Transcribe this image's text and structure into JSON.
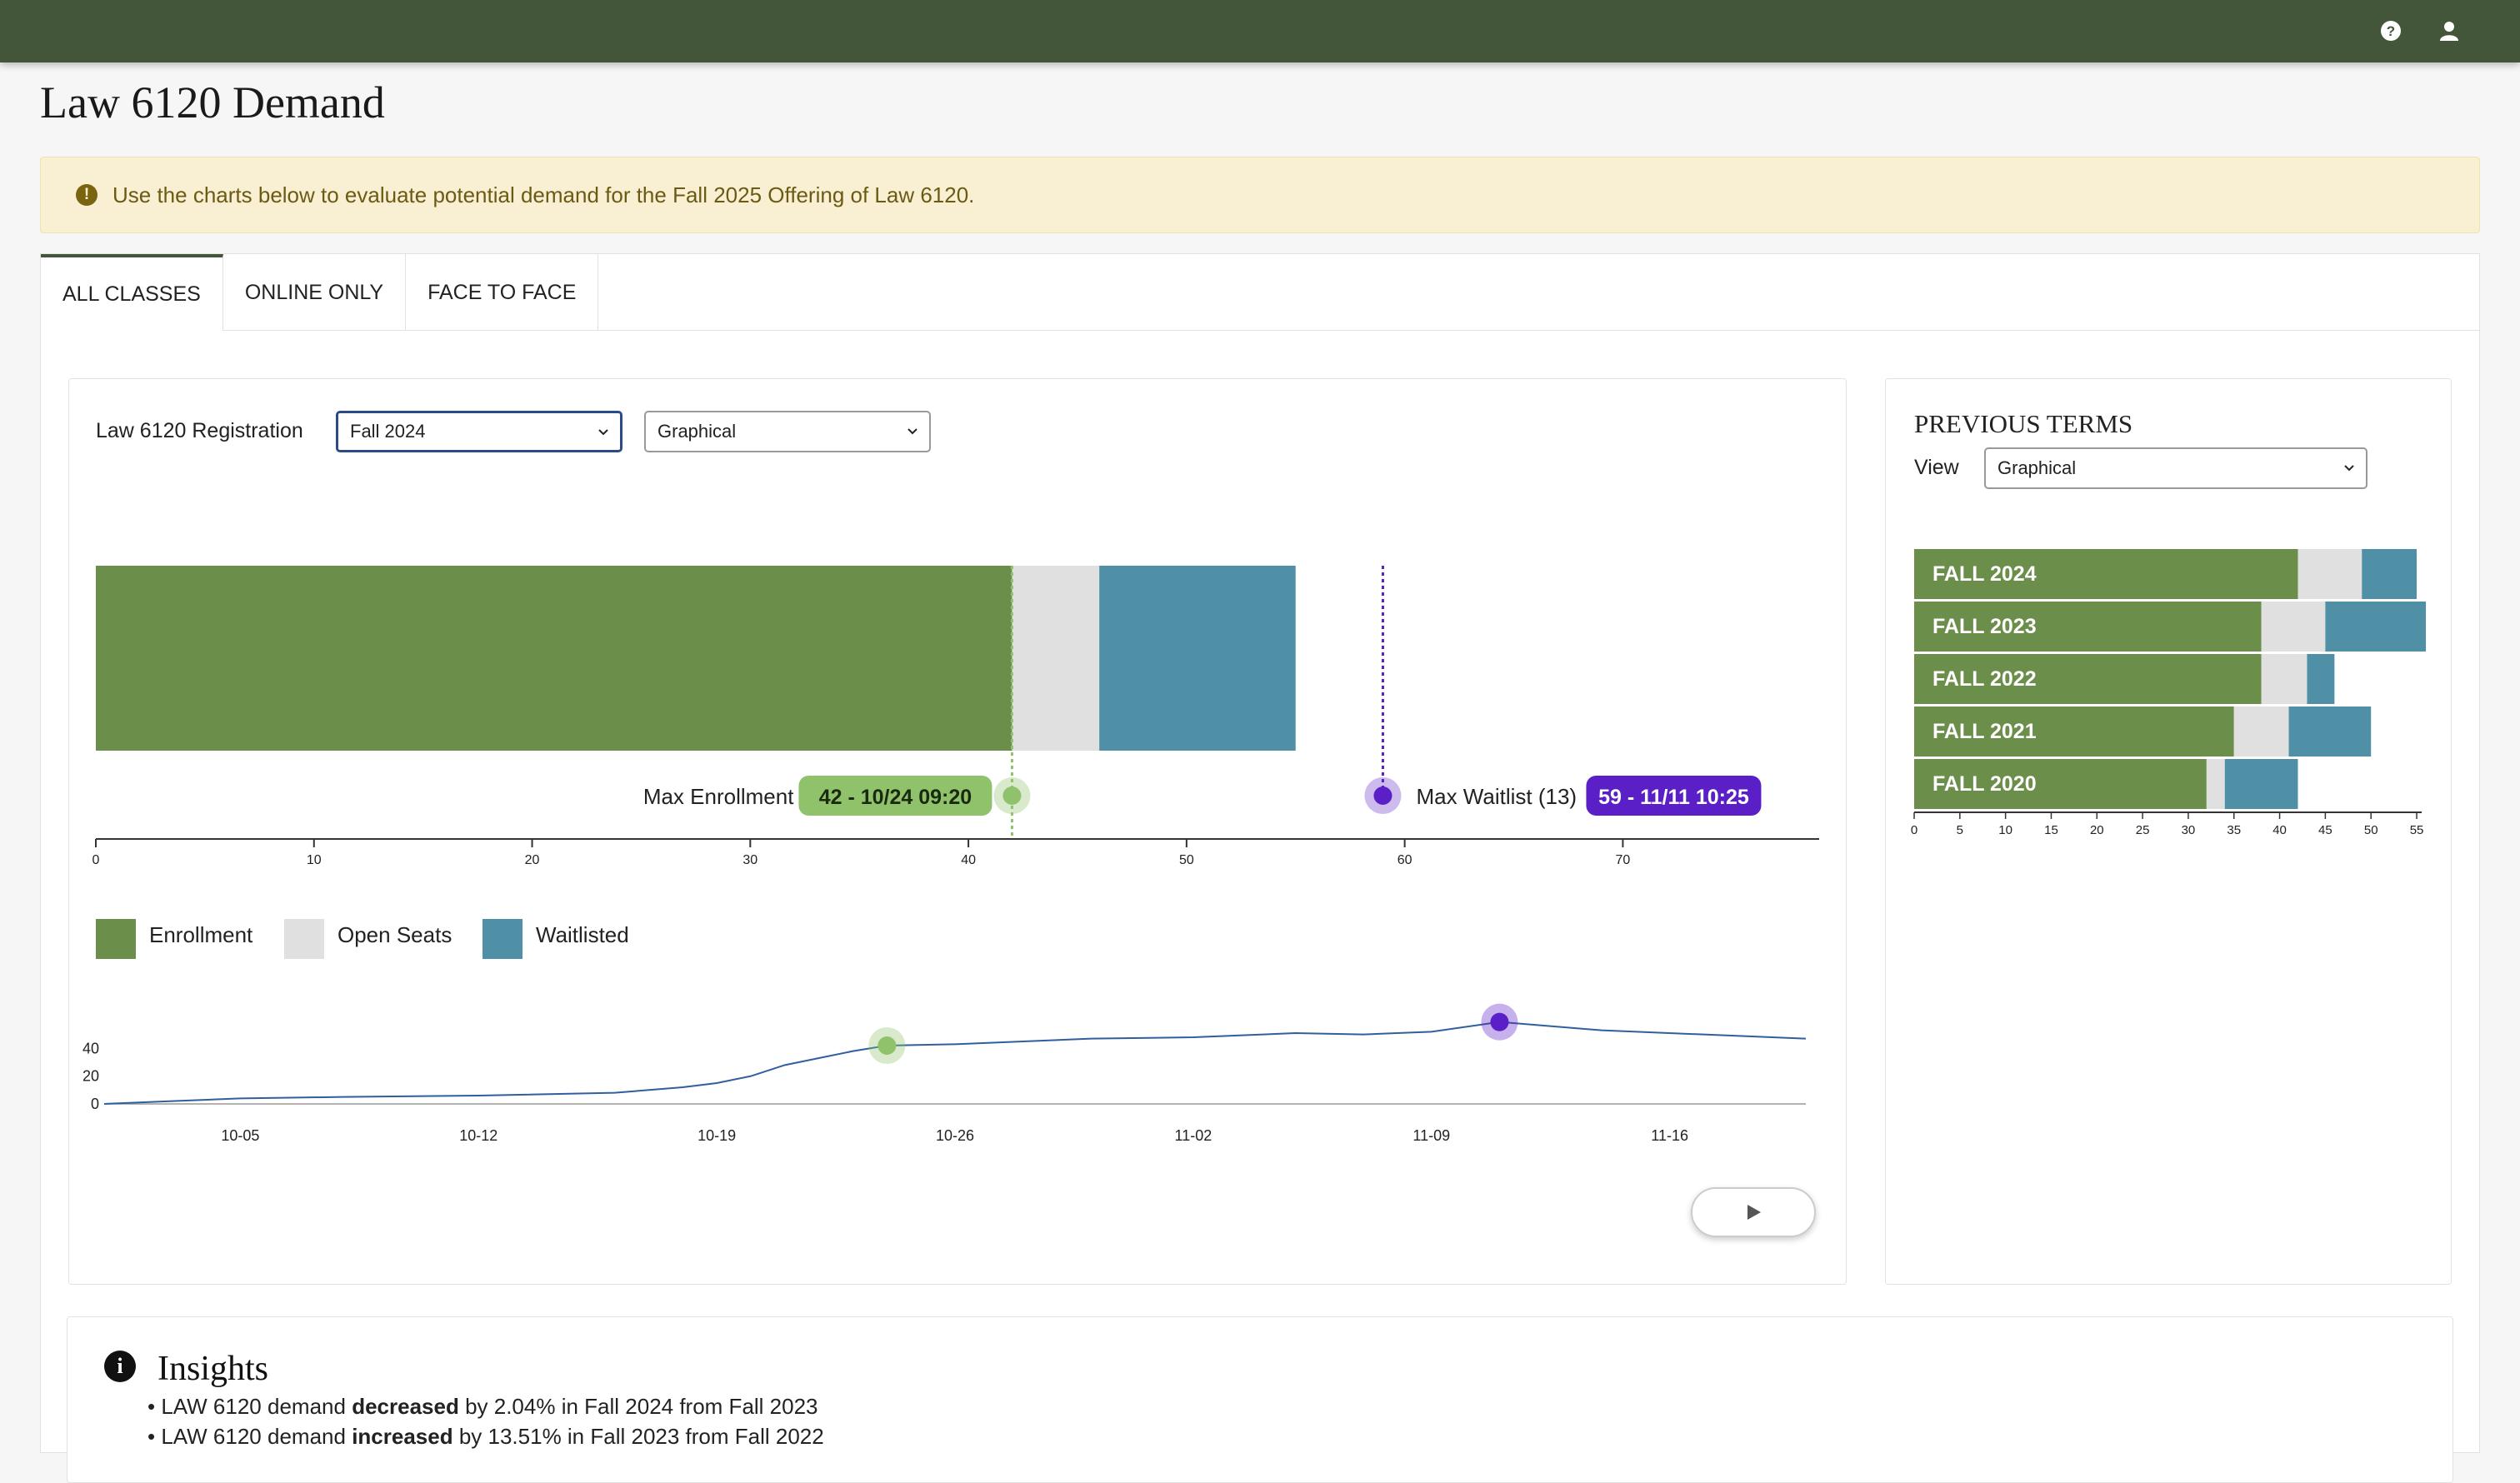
{
  "page": {
    "title": "Law 6120 Demand"
  },
  "alert": {
    "text": "Use the charts below to evaluate potential demand for the Fall 2025 Offering of Law 6120."
  },
  "tabs": [
    {
      "label": "ALL CLASSES",
      "active": true
    },
    {
      "label": "ONLINE ONLY",
      "active": false
    },
    {
      "label": "FACE TO FACE",
      "active": false
    }
  ],
  "registration": {
    "label": "Law 6120 Registration",
    "term_select": "Fall 2024",
    "view_select": "Graphical"
  },
  "legend": [
    {
      "label": "Enrollment",
      "color": "#6b8f4b"
    },
    {
      "label": "Open Seats",
      "color": "#e0e0e0"
    },
    {
      "label": "Waitlisted",
      "color": "#5090a6"
    }
  ],
  "markers": {
    "max_enrollment_label": "Max Enrollment",
    "max_enrollment_badge": "42 - 10/24 09:20",
    "max_waitlist_label": "Max Waitlist (13)",
    "max_waitlist_badge": "59 - 11/11 10:25"
  },
  "previous_terms": {
    "title": "PREVIOUS TERMS",
    "view_label": "View",
    "view_select": "Graphical"
  },
  "insights": {
    "title": "Insights",
    "lines": [
      {
        "pre": "LAW 6120 demand ",
        "bold": "decreased",
        "post": " by 2.04% in Fall 2024 from Fall 2023"
      },
      {
        "pre": "LAW 6120 demand ",
        "bold": "increased",
        "post": " by 13.51% in Fall 2023 from Fall 2022"
      }
    ]
  },
  "colors": {
    "header": "#43563a",
    "enroll": "#6b8f4b",
    "open": "#e0e0e0",
    "wait": "#5090a6",
    "purple": "#5b1fc8",
    "green_badge": "#8fc26a"
  },
  "chart_data": [
    {
      "type": "bar",
      "title": "",
      "orientation": "horizontal-stacked",
      "categories": [
        "Fall 2024"
      ],
      "series": [
        {
          "name": "Enrollment",
          "values": [
            42
          ]
        },
        {
          "name": "Open Seats",
          "values": [
            4
          ]
        },
        {
          "name": "Waitlisted",
          "values": [
            9
          ]
        }
      ],
      "annotations": [
        {
          "label": "Max Enrollment",
          "value": 42,
          "badge": "42 - 10/24 09:20"
        },
        {
          "label": "Max Waitlist (13)",
          "value": 59,
          "badge": "59 - 11/11 10:25"
        }
      ],
      "xlim": [
        0,
        79
      ],
      "xticks": [
        0,
        10,
        20,
        30,
        40,
        50,
        60,
        70
      ]
    },
    {
      "type": "line",
      "title": "",
      "x": [
        "10-01",
        "10-03",
        "10-05",
        "10-08",
        "10-12",
        "10-16",
        "10-18",
        "10-19",
        "10-20",
        "10-21",
        "10-22",
        "10-23",
        "10-24",
        "10-26",
        "10-28",
        "10-30",
        "11-02",
        "11-05",
        "11-07",
        "11-09",
        "11-11",
        "11-14",
        "11-17",
        "11-20"
      ],
      "y": [
        0,
        2,
        4,
        5,
        6,
        8,
        12,
        15,
        20,
        28,
        33,
        38,
        42,
        43,
        45,
        47,
        48,
        51,
        50,
        52,
        59,
        53,
        50,
        47
      ],
      "xticks": [
        "10-05",
        "10-12",
        "10-19",
        "10-26",
        "11-02",
        "11-09",
        "11-16"
      ],
      "yticks": [
        0,
        20,
        40
      ],
      "highlights": [
        {
          "x": "10-24",
          "y": 42,
          "color": "green"
        },
        {
          "x": "11-11",
          "y": 59,
          "color": "purple"
        }
      ]
    },
    {
      "type": "bar",
      "title": "PREVIOUS TERMS",
      "orientation": "horizontal-stacked",
      "categories": [
        "FALL 2024",
        "FALL 2023",
        "FALL 2022",
        "FALL 2021",
        "FALL 2020"
      ],
      "series": [
        {
          "name": "Enrollment",
          "values": [
            42,
            38,
            38,
            35,
            32
          ]
        },
        {
          "name": "Open Seats",
          "values": [
            7,
            7,
            5,
            6,
            2
          ]
        },
        {
          "name": "Waitlisted",
          "values": [
            6,
            11,
            3,
            9,
            8
          ]
        }
      ],
      "xlim": [
        0,
        56
      ],
      "xticks": [
        0,
        5,
        10,
        15,
        20,
        25,
        30,
        35,
        40,
        45,
        50,
        55
      ]
    }
  ]
}
